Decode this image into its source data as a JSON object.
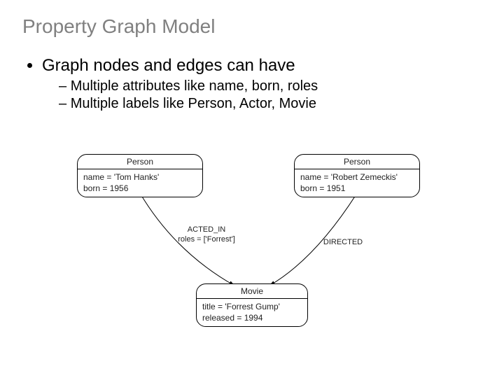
{
  "title": "Property Graph Model",
  "bullets": {
    "main": "Graph nodes and edges can have",
    "sub1": "Multiple attributes like name, born, roles",
    "sub2": "Multiple labels like Person, Actor, Movie"
  },
  "nodes": {
    "person1": {
      "label": "Person",
      "attrs": "name = 'Tom Hanks'\nborn = 1956"
    },
    "person2": {
      "label": "Person",
      "attrs": "name = 'Robert Zemeckis'\nborn = 1951"
    },
    "movie": {
      "label": "Movie",
      "attrs": "title = 'Forrest Gump'\nreleased = 1994"
    }
  },
  "edges": {
    "acted": "ACTED_IN\nroles = ['Forrest']",
    "directed": "DIRECTED"
  }
}
